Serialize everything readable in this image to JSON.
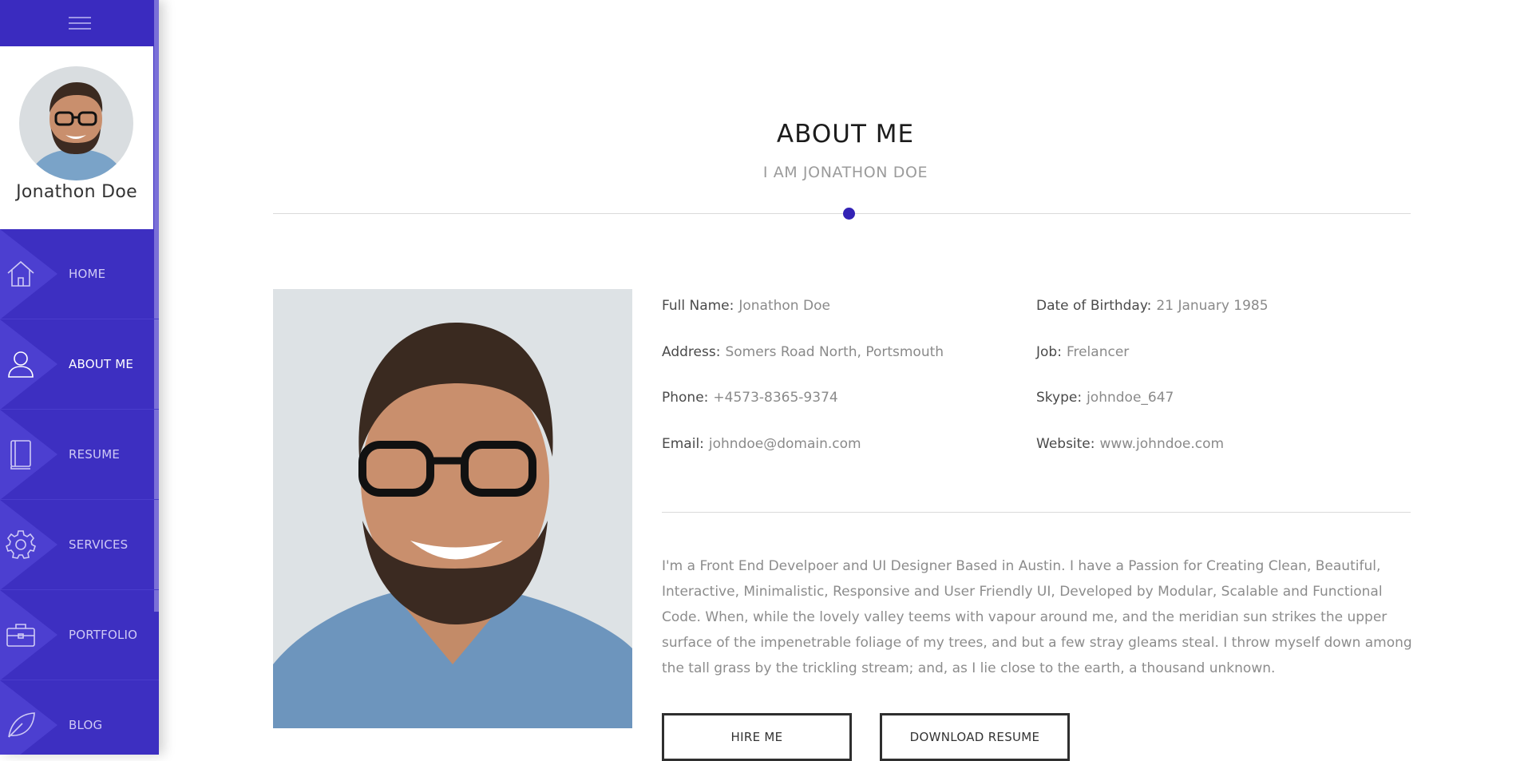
{
  "sidebar": {
    "profile_name": "Jonathon Doe",
    "items": [
      {
        "label": "HOME",
        "icon": "home-icon"
      },
      {
        "label": "ABOUT ME",
        "icon": "user-icon",
        "active": true
      },
      {
        "label": "RESUME",
        "icon": "book-icon"
      },
      {
        "label": "SERVICES",
        "icon": "gear-icon"
      },
      {
        "label": "PORTFOLIO",
        "icon": "briefcase-icon"
      },
      {
        "label": "BLOG",
        "icon": "leaf-icon"
      }
    ]
  },
  "about": {
    "title": "ABOUT ME",
    "subtitle": "I AM JONATHON DOE"
  },
  "info": {
    "left": [
      {
        "key": "Full Name:",
        "value": "Jonathon Doe"
      },
      {
        "key": "Address:",
        "value": "Somers Road North, Portsmouth"
      },
      {
        "key": "Phone:",
        "value": "+4573-8365-9374"
      },
      {
        "key": "Email:",
        "value": "johndoe@domain.com"
      }
    ],
    "right": [
      {
        "key": "Date of Birthday:",
        "value": "21 January 1985"
      },
      {
        "key": "Job:",
        "value": "Frelancer"
      },
      {
        "key": "Skype:",
        "value": "johndoe_647"
      },
      {
        "key": "Website:",
        "value": "www.johndoe.com"
      }
    ]
  },
  "bio": "I'm a Front End Develpoer and UI Designer Based in Austin. I have a Passion for Creating Clean, Beautiful, Interactive, Minimalistic, Responsive and User Friendly UI, Developed by Modular, Scalable and Functional Code. When, while the lovely valley teems with vapour around me, and the meridian sun strikes the upper surface of the impenetrable foliage of my trees, and but a few stray gleams steal. I throw myself down among the tall grass by the trickling stream; and, as I lie close to the earth, a thousand unknown.",
  "buttons": {
    "hire": "HIRE ME",
    "download": "DOWNLOAD RESUME"
  },
  "colors": {
    "sidebar": "#3d2fc1",
    "accent": "#3322b5"
  }
}
